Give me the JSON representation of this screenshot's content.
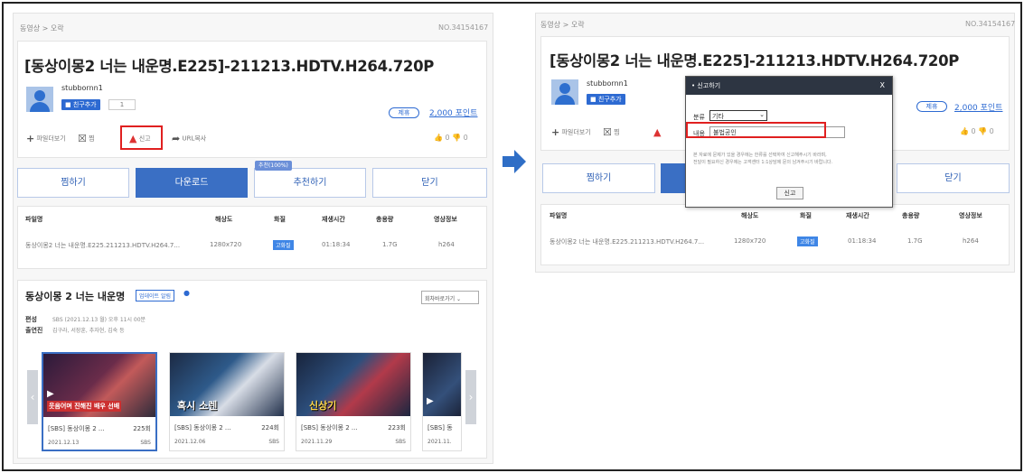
{
  "post": {
    "breadcrumb": "동영상 > 오락",
    "number": "NO.34154167",
    "title": "[동상이몽2 너는 내운명.E225]-211213.HDTV.H264.720P",
    "username": "stubbornn1",
    "add_friend": "친구추가",
    "friend_count": "1",
    "pay_tag": "제휴",
    "points": "2,000 포인트",
    "tools": {
      "file_view": "파일더보기",
      "favorite": "찜",
      "report": "신고",
      "url_copy": "URL복사"
    },
    "likes": "0",
    "dislikes": "0"
  },
  "actions": {
    "wish": "찜하기",
    "download": "다운로드",
    "recommend": "추천하기",
    "recommend_badge": "추천(100%)",
    "close": "닫기"
  },
  "file_table": {
    "headers": [
      "파일명",
      "해상도",
      "화질",
      "재생시간",
      "총용량",
      "영상정보"
    ],
    "row": {
      "name": "동상이몽2 너는 내운명.E225.211213.HDTV.H264.7...",
      "resolution": "1280x720",
      "quality": "고화질",
      "duration": "01:18:34",
      "size": "1.7G",
      "codec": "h264"
    }
  },
  "program": {
    "title": "동상이몽 2 너는 내운명",
    "update_badge": "업데이트 알림",
    "dropdown": "회차바로가기",
    "schedule_label": "편성",
    "schedule_value": "SBS (2021.12.13 월) 오후 11시 00분",
    "cast_label": "출연진",
    "cast_value": "김구라, 서장훈, 추자현, 김숙 등",
    "episodes": [
      {
        "caption": "[SBS] 동상이몽 2 ...",
        "ep": "225회",
        "date": "2021.12.13",
        "network": "SBS"
      },
      {
        "caption": "[SBS] 동상이몽 2 ...",
        "ep": "224회",
        "date": "2021.12.06",
        "network": "SBS"
      },
      {
        "caption": "[SBS] 동상이몽 2 ...",
        "ep": "223회",
        "date": "2021.11.29",
        "network": "SBS"
      },
      {
        "caption": "[SBS] 동",
        "ep": "",
        "date": "2021.11.",
        "network": ""
      }
    ],
    "thumb_texts": [
      "웃음어며 진해진 배우 선배",
      "혹시 소렌",
      "신상기"
    ]
  },
  "report_dialog": {
    "title": "신고하기",
    "close": "X",
    "category_label": "분류",
    "category_value": "기타",
    "content_label": "내용",
    "content_value": "불법공인",
    "notice_1": "본 자료에 문제가 있을 경우에는 한류를 선택하여 신고해주시기 바라며,",
    "notice_2": "전달이 필요하신 경우에는 고객센터 1:1상담에 문의 남겨주시기 바랍니다.",
    "submit": "신고"
  },
  "colors": {
    "accent": "#3a6fc4",
    "highlight": "#e02020",
    "dialog_header": "#2d3542",
    "arrow": "#2f6ec6"
  }
}
